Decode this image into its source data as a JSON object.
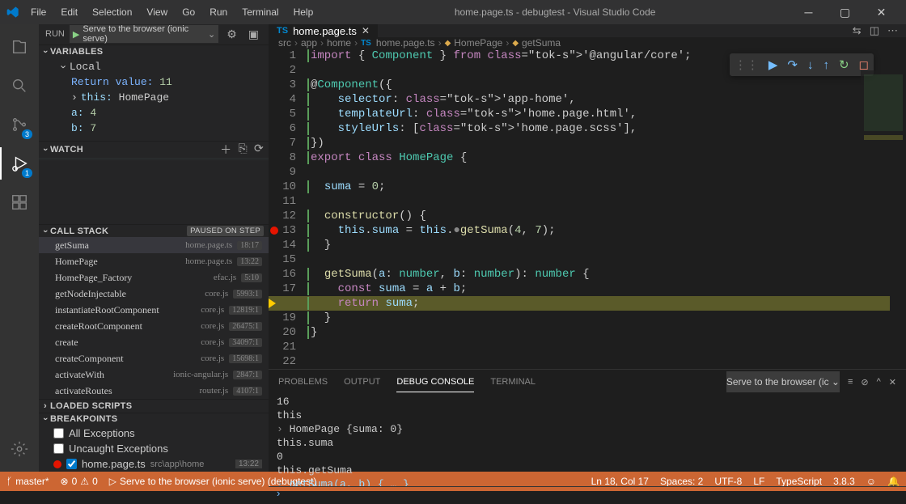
{
  "title": "home.page.ts - debugtest - Visual Studio Code",
  "menu": [
    "File",
    "Edit",
    "Selection",
    "View",
    "Go",
    "Run",
    "Terminal",
    "Help"
  ],
  "run": {
    "label": "RUN",
    "config": "Serve to the browser (ionic serve)"
  },
  "sections": {
    "variables": "VARIABLES",
    "watch": "WATCH",
    "callstack": "CALL STACK",
    "loaded": "LOADED SCRIPTS",
    "breakpoints": "BREAKPOINTS"
  },
  "vars": {
    "scope": "Local",
    "ret": "Return value:",
    "retv": "11",
    "this": "this:",
    "thisType": "HomePage",
    "a": "a:",
    "av": "4",
    "b": "b:",
    "bv": "7"
  },
  "callstack": {
    "status": "PAUSED ON STEP",
    "items": [
      {
        "name": "getSuma",
        "file": "home.page.ts",
        "loc": "18:17"
      },
      {
        "name": "HomePage",
        "file": "home.page.ts",
        "loc": "13:22"
      },
      {
        "name": "HomePage_Factory",
        "file": "efac.js",
        "loc": "5:10"
      },
      {
        "name": "getNodeInjectable",
        "file": "core.js",
        "loc": "5993:1"
      },
      {
        "name": "instantiateRootComponent",
        "file": "core.js",
        "loc": "12819:1"
      },
      {
        "name": "createRootComponent",
        "file": "core.js",
        "loc": "26475:1"
      },
      {
        "name": "create",
        "file": "core.js",
        "loc": "34097:1"
      },
      {
        "name": "createComponent",
        "file": "core.js",
        "loc": "15698:1"
      },
      {
        "name": "activateWith",
        "file": "ionic-angular.js",
        "loc": "2847:1"
      },
      {
        "name": "activateRoutes",
        "file": "router.js",
        "loc": "4107:1"
      }
    ]
  },
  "breakpoints": {
    "all": "All Exceptions",
    "uncaught": "Uncaught Exceptions",
    "file": "home.page.ts",
    "path": "src\\app\\home",
    "loc": "13:22"
  },
  "tab": {
    "name": "home.page.ts"
  },
  "breadcrumb": [
    "src",
    "app",
    "home",
    "home.page.ts",
    "HomePage",
    "getSuma"
  ],
  "code": [
    "import { Component } from '@angular/core';",
    "",
    "@Component({",
    "    selector: 'app-home',",
    "    templateUrl: 'home.page.html',",
    "    styleUrls: ['home.page.scss'],",
    "})",
    "export class HomePage {",
    "",
    "  suma = 0;",
    "",
    "  constructor() {",
    "    this.suma = this.●getSuma(4, 7);",
    "  }",
    "",
    "  getSuma(a: number, b: number): number {",
    "    const suma = a + b;",
    "    return suma;",
    "  }",
    "}",
    "",
    ""
  ],
  "panel": {
    "tabs": [
      "PROBLEMS",
      "OUTPUT",
      "DEBUG CONSOLE",
      "TERMINAL"
    ],
    "active": 2,
    "select": "Serve to the browser (ic",
    "lines": [
      "16",
      "this",
      "HomePage {suma: 0}",
      "this.suma",
      "0",
      "this.getSuma",
      "getSuma(a, b) { … }"
    ]
  },
  "status": {
    "branch": "master*",
    "errors": "0",
    "warnings": "0",
    "launch": "Serve to the browser (ionic serve) (debugtest)",
    "pos": "Ln 18, Col 17",
    "spaces": "Spaces: 2",
    "enc": "UTF-8",
    "eol": "LF",
    "lang": "TypeScript",
    "ver": "3.8.3"
  }
}
